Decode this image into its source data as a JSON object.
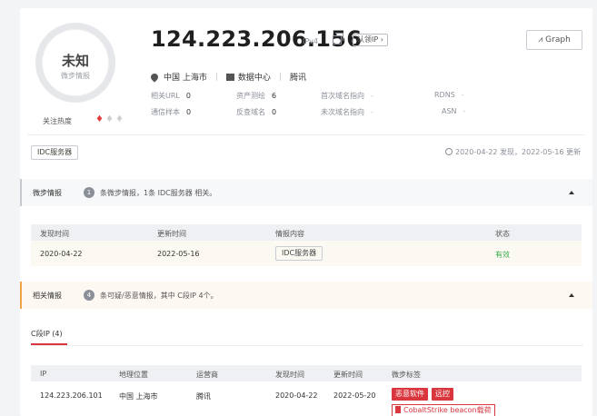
{
  "profile": {
    "status": "未知",
    "status_sub": "微步情报",
    "heat_label": "关注热度",
    "heat_icons": [
      "flame-on",
      "flame-off",
      "flame-off"
    ]
  },
  "header": {
    "ip": "124.223.206.156",
    "ip_type": "IPv4",
    "claim_label": "认领IP",
    "graph_label": "Graph",
    "location": "中国 上海市",
    "usage": "数据中心",
    "carrier": "腾讯"
  },
  "meta": {
    "related_url_label": "相关URL",
    "related_url_value": "0",
    "asset_label": "资产测绘",
    "asset_value": "6",
    "first_domain_label": "首次域名指向",
    "first_domain_value": "-",
    "rdns_label": "RDNS",
    "rdns_value": "-",
    "samples_label": "通信样本",
    "samples_value": "0",
    "reverse_label": "反查域名",
    "reverse_value": "0",
    "last_domain_label": "未次域名指向",
    "last_domain_value": "-",
    "asn_label": "ASN",
    "asn_value": "-"
  },
  "tags": {
    "label": "IDC服务器",
    "dates": "2020-04-22 发现，2022-05-16 更新"
  },
  "intel": {
    "title": "微步情报",
    "count": "1",
    "summary": "条微步情报，1条 IDC服务器 相关。",
    "columns": [
      "发现时间",
      "更新时间",
      "情报内容",
      "状态"
    ],
    "rows": [
      {
        "found": "2020-04-22",
        "updated": "2022-05-16",
        "content": "IDC服务器",
        "status": "有效"
      }
    ]
  },
  "related": {
    "title": "相关情报",
    "count": "4",
    "summary": "条可疑/恶意情报，其中 C段IP 4个。",
    "tab_label": "C段IP (4)",
    "columns": [
      "IP",
      "地理位置",
      "运营商",
      "发现时间",
      "更新时间",
      "微步标签"
    ],
    "rows": [
      {
        "ip": "124.223.206.101",
        "location": "中国 上海市",
        "carrier": "腾讯",
        "found": "2020-04-22",
        "updated": "2022-05-20",
        "tags": [
          "恶意软件",
          "远控"
        ],
        "extra_tag": "CobaltStrike beacon载荷"
      }
    ]
  },
  "colors": {
    "accent_red": "#d9363e",
    "ok_green": "#3aab4a",
    "orange": "#f0a347"
  }
}
